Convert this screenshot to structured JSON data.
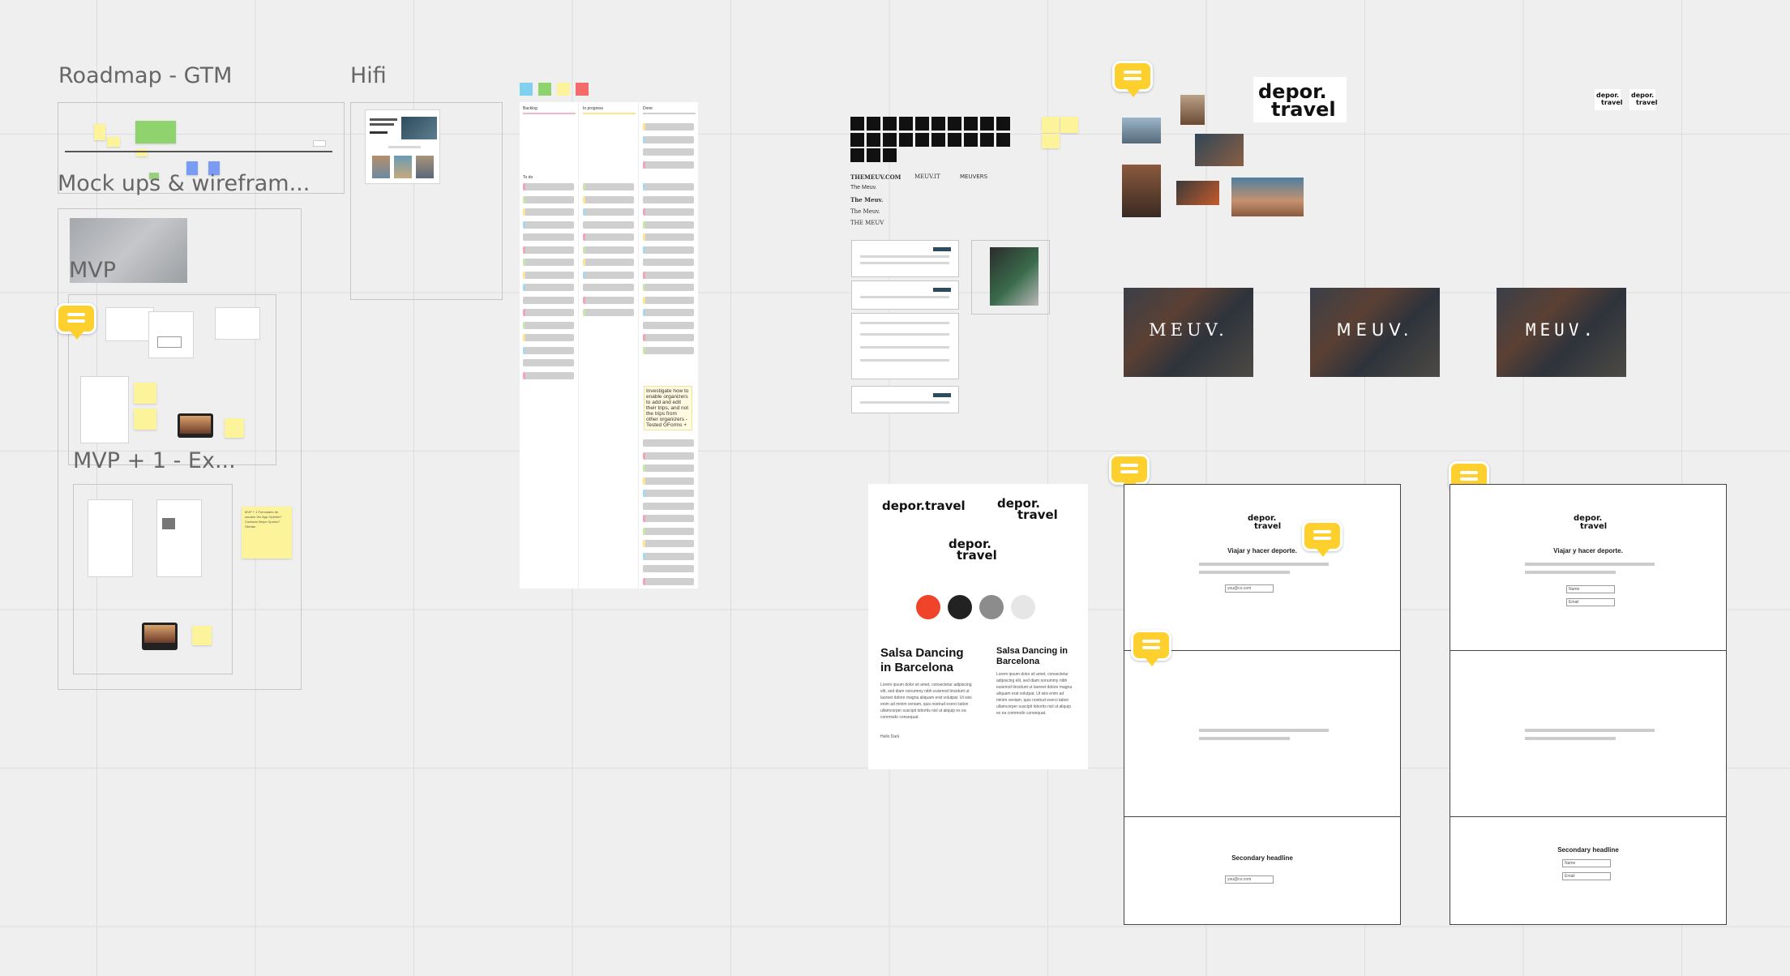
{
  "frames": {
    "roadmap": "Roadmap - GTM",
    "hifi": "Hifi",
    "mockups": "Mock ups & wirefram...",
    "mvp": "MVP",
    "mvp_plus": "MVP + 1 - Ex..."
  },
  "kanban": {
    "columns": [
      "Backlog",
      "In progress",
      "Done"
    ],
    "counts": [
      "12",
      "3",
      "22"
    ],
    "todo_label": "To do",
    "todo_count": "18",
    "note": "Investigate how to enable organizers to add and edit their trips, and not the trips from other organizers - Tested GForms +"
  },
  "fonts_sample": {
    "row1": [
      "THEMEUV.COM",
      "MEUV.IT",
      "MEUVERS"
    ],
    "rows": [
      "The Meuv.",
      "The Meuv.",
      "The Meuv.",
      "THE MEUV"
    ]
  },
  "brand": {
    "logo_line1": "depor.",
    "logo_line2": "travel",
    "logo_inline": "depor.travel",
    "meuv_text": [
      "MEUV.",
      "MEUV.",
      "MEUV."
    ]
  },
  "style_guide": {
    "colors": [
      "#f0442a",
      "#222222",
      "#8c8c8c",
      "#e6e6e6"
    ],
    "heading_large": "Salsa Dancing in Barcelona",
    "heading_small": "Salsa Dancing in Barcelona",
    "body": "Lorem ipsum dolor sit amet, consectetur adipiscing elit, sed diam nonummy nibh euismod tincidunt ut laoreet dolore magna aliquam erat volutpat. Ut wisi enim ad minim veniam, quis nostrud exerci tation ullamcorper suscipit lobortis nisl ut aliquip ex ea commodo consequat.",
    "signoff": "Hello Dark"
  },
  "landing": {
    "tagline": "Viajar y hacer deporte.",
    "email_placeholder": "you@co.com",
    "name_placeholder": "Name",
    "email_label": "Email",
    "secondary": "Secondary headline"
  },
  "mvp_sticky": "MVP + 1 Formulario de usuario Ver App Opinión? Contacto Mejor Opción? Ofertas"
}
